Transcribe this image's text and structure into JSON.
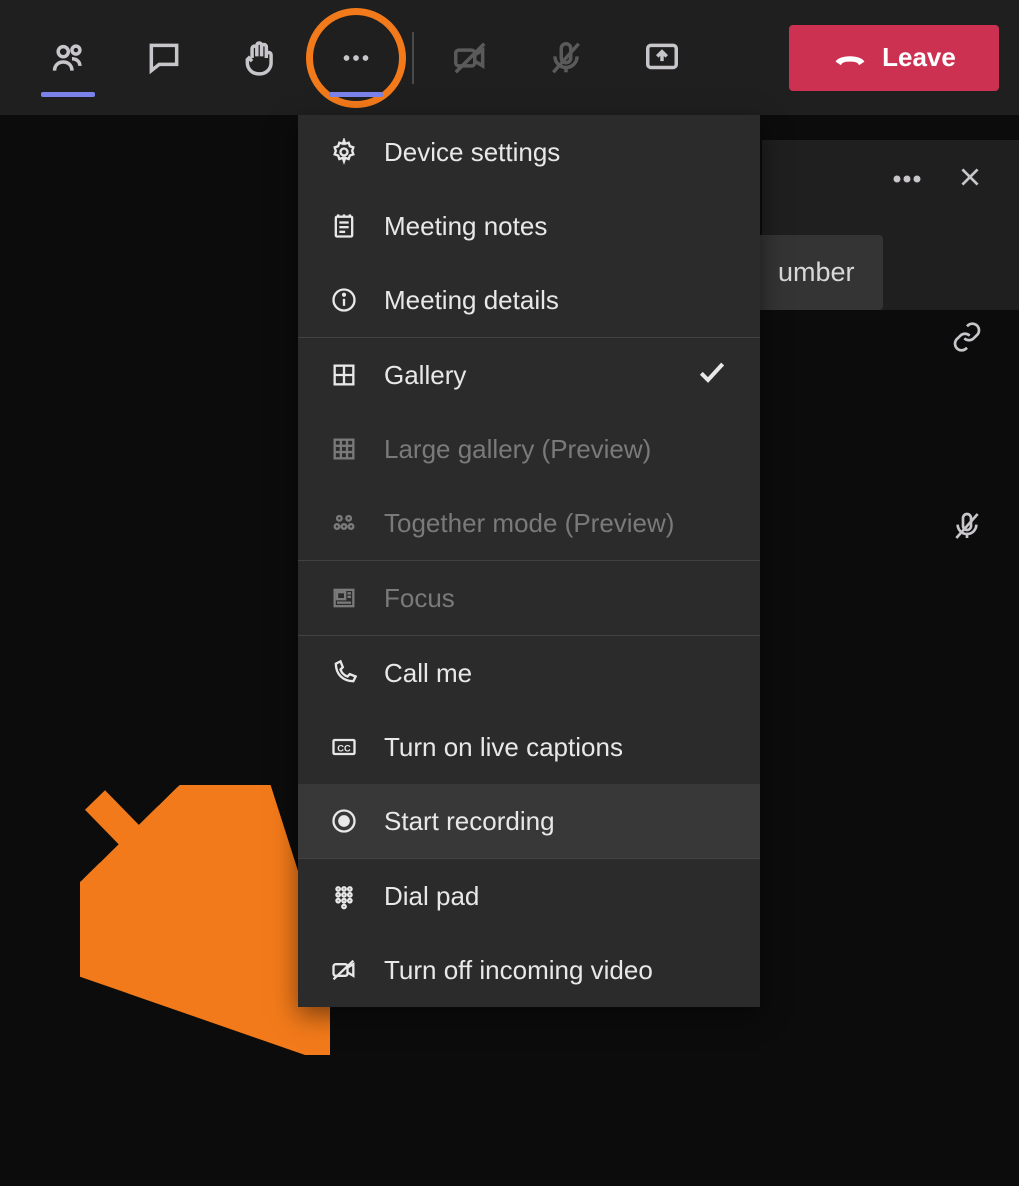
{
  "toolbar": {
    "leave_label": "Leave"
  },
  "menu": {
    "device_settings": "Device settings",
    "meeting_notes": "Meeting notes",
    "meeting_details": "Meeting details",
    "gallery": "Gallery",
    "large_gallery": "Large gallery (Preview)",
    "together_mode": "Together mode (Preview)",
    "focus": "Focus",
    "call_me": "Call me",
    "live_captions": "Turn on live captions",
    "start_recording": "Start recording",
    "dial_pad": "Dial pad",
    "turn_off_video": "Turn off incoming video"
  },
  "side_panel": {
    "partial_text": "umber"
  },
  "colors": {
    "accent": "#7b83eb",
    "danger": "#cc3152",
    "annotation": "#f27a1a"
  }
}
